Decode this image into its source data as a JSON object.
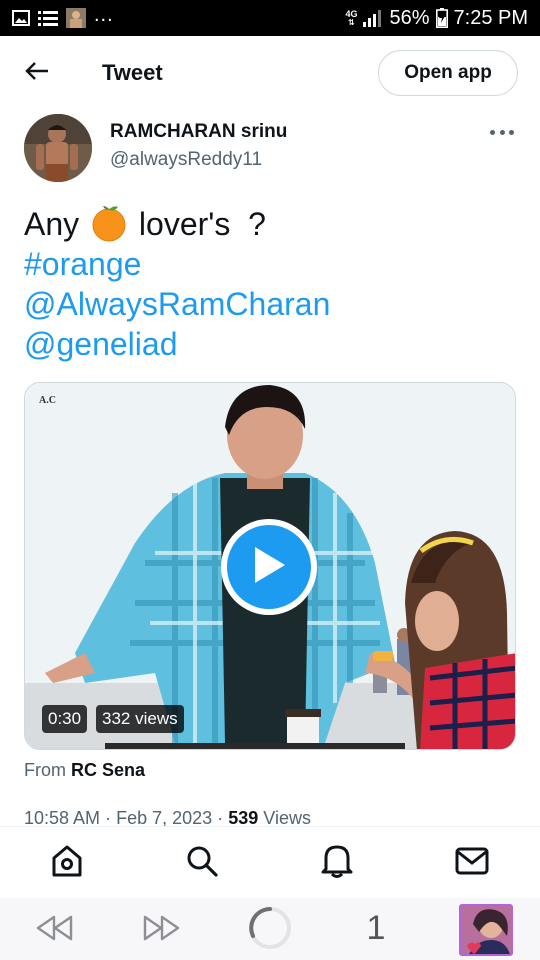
{
  "status_bar": {
    "overflow_indicator": "...",
    "network_type": "4G",
    "battery": "56%",
    "time": "7:25 PM",
    "icons": [
      "image-notification-icon",
      "list-notification-icon",
      "profile-notification-icon",
      "signal-icon",
      "battery-icon"
    ]
  },
  "header": {
    "title": "Tweet",
    "back_icon": "arrow-left-icon",
    "open_app_label": "Open app"
  },
  "author": {
    "name": "RAMCHARAN srinu",
    "handle": "@alwaysReddy11"
  },
  "tweet": {
    "text_before_emoji": "Any",
    "emoji": "orange",
    "text_after_emoji": "lover's  ?",
    "hashtag": "#orange",
    "mentions": [
      "@AlwaysRamCharan",
      "@geneliad"
    ]
  },
  "media": {
    "watermark": "A.C",
    "duration": "0:30",
    "views": "332 views",
    "play_icon": "play-icon"
  },
  "source": {
    "prefix": "From",
    "name": "RC Sena"
  },
  "meta": {
    "time": "10:58 AM",
    "separator": "·",
    "date": "Feb 7, 2023",
    "view_count": "539",
    "view_label": "Views"
  },
  "bottom_nav": {
    "items": [
      "home-icon",
      "search-icon",
      "notifications-icon",
      "messages-icon"
    ]
  },
  "browser_bar": {
    "tab_count": "1",
    "items": [
      "rewind-icon",
      "forward-icon",
      "loading-icon",
      "tab-count",
      "tab-thumbnail"
    ]
  },
  "colors": {
    "accent": "#1d9bf0",
    "text_primary": "#0f1419",
    "text_secondary": "#536471",
    "border": "#cfd9de",
    "status_bar_bg": "#000000"
  }
}
